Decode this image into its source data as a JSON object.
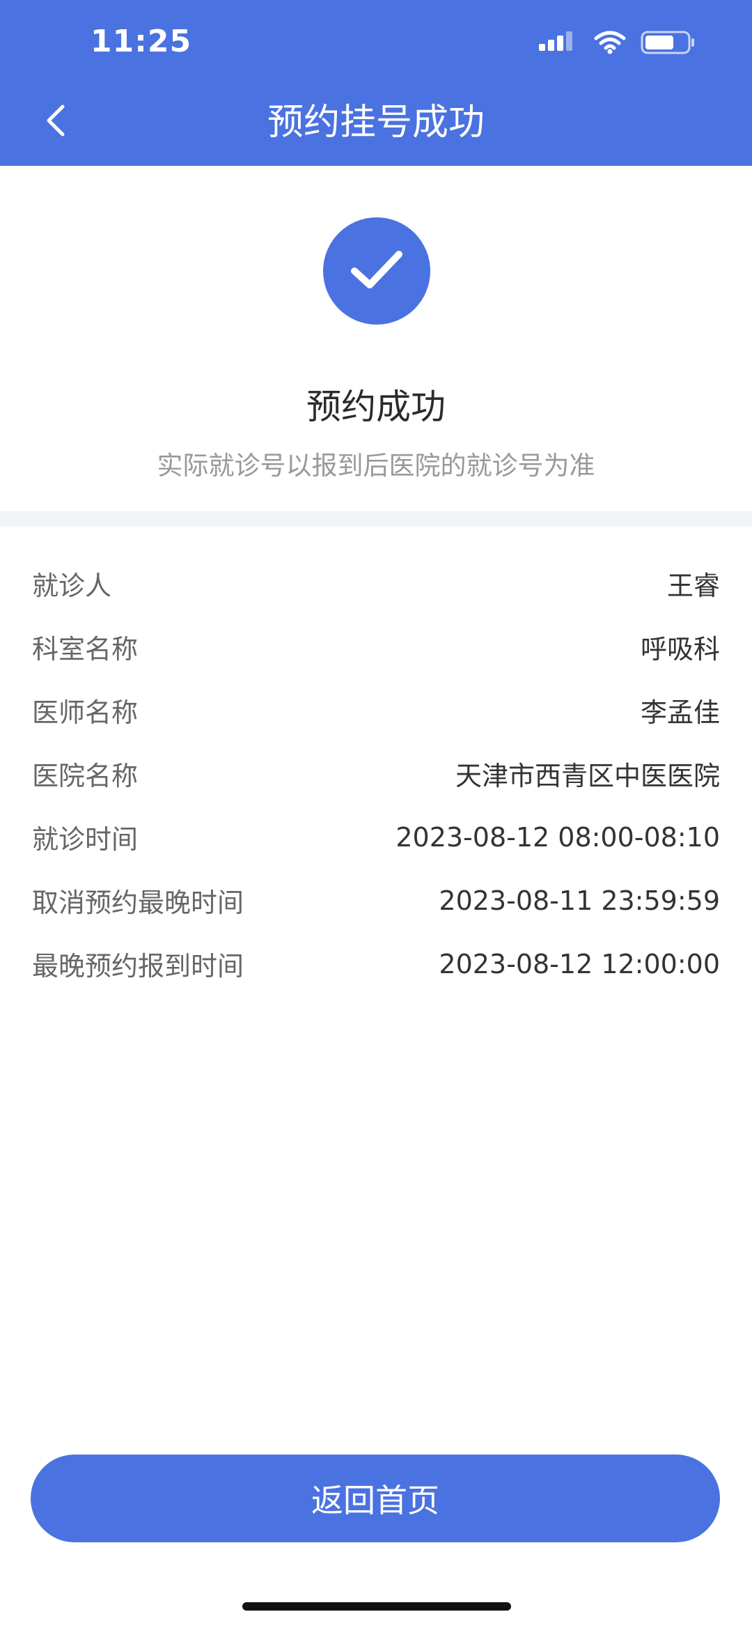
{
  "status_bar": {
    "time": "11:25"
  },
  "nav": {
    "title": "预约挂号成功"
  },
  "success": {
    "title": "预约成功",
    "subtitle": "实际就诊号以报到后医院的就诊号为准"
  },
  "details": [
    {
      "label": "就诊人",
      "value": "王睿"
    },
    {
      "label": "科室名称",
      "value": "呼吸科"
    },
    {
      "label": "医师名称",
      "value": "李孟佳"
    },
    {
      "label": "医院名称",
      "value": "天津市西青区中医医院"
    },
    {
      "label": "就诊时间",
      "value": "2023-08-12 08:00-08:10"
    },
    {
      "label": "取消预约最晚时间",
      "value": "2023-08-11 23:59:59"
    },
    {
      "label": "最晚预约报到时间",
      "value": "2023-08-12 12:00:00"
    }
  ],
  "actions": {
    "home_label": "返回首页"
  },
  "icons": {
    "back": "chevron-left-icon",
    "success": "check-icon",
    "signal": "cellular-signal-icon",
    "wifi": "wifi-icon",
    "battery": "battery-icon"
  },
  "colors": {
    "primary": "#4a72e0",
    "label": "#666666",
    "value": "#333333",
    "subtitle": "#999999",
    "band": "#f3f4f8"
  }
}
